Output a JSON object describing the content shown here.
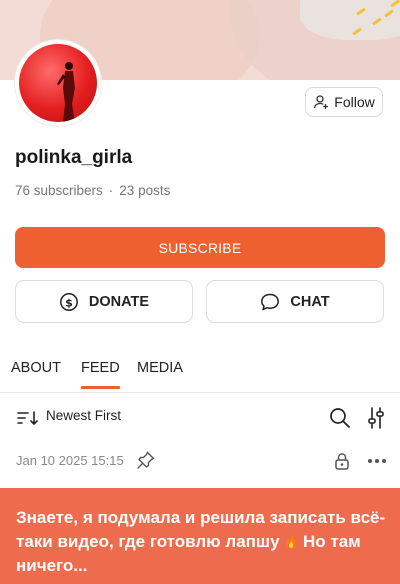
{
  "profile": {
    "username": "polinka_girla",
    "subscribers": "76 subscribers",
    "separator": "·",
    "posts": "23 posts"
  },
  "buttons": {
    "follow": "Follow",
    "subscribe": "SUBSCRIBE",
    "donate": "DONATE",
    "chat": "CHAT"
  },
  "tabs": [
    "ABOUT",
    "FEED",
    "MEDIA"
  ],
  "active_tab": "FEED",
  "sort": {
    "label": "Newest First"
  },
  "post": {
    "date": "Jan 10 2025 15:15",
    "text_part1": "Знаете, я подумала и решила записать всё-таки видео, где готовлю лапшу ",
    "text_part2": " Но там ничего..."
  },
  "colors": {
    "accent": "#ef6031",
    "banner": "#ee6c4d",
    "cover": "#f2dcd5",
    "avatar_red": "#e41f1f"
  }
}
